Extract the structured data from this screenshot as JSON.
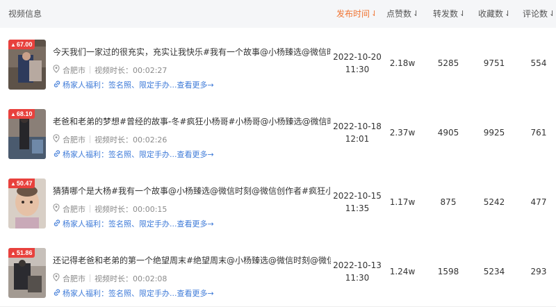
{
  "header": {
    "info": "视频信息",
    "publish_time": "发布时间",
    "likes": "点赞数",
    "shares": "转发数",
    "favorites": "收藏数",
    "comments": "评论数",
    "sort_arrow": "⇃"
  },
  "colors": {
    "accent": "#f07432",
    "badge": "#e8413d",
    "link": "#3f7bd8"
  },
  "rows": [
    {
      "score": "67.00",
      "title": "今天我们一家过的很充实，充实让我快乐#我有一个故事@小杨臻选@微信时...",
      "city": "合肥市",
      "duration_label": "视频时长：",
      "duration": "00:02:27",
      "promo": "杨家人福利：签名照、限定手办...查看更多→",
      "date": "2022-10-20",
      "time": "11:30",
      "likes": "2.18w",
      "shares": "5285",
      "favorites": "9751",
      "comments": "554"
    },
    {
      "score": "68.10",
      "title": "老爸和老弟的梦想#曾经的故事-冬#疯狂小杨哥#小杨哥@小杨臻选@微信时刻...",
      "city": "合肥市",
      "duration_label": "视频时长：",
      "duration": "00:02:26",
      "promo": "杨家人福利：签名照、限定手办...查看更多→",
      "date": "2022-10-18",
      "time": "12:01",
      "likes": "2.37w",
      "shares": "4905",
      "favorites": "9925",
      "comments": "761"
    },
    {
      "score": "50.47",
      "title": "猜猜哪个是大杨#我有一个故事@小杨臻选@微信时刻@微信创作者#疯狂小杨哥",
      "city": "合肥市",
      "duration_label": "视频时长：",
      "duration": "00:00:15",
      "promo": "杨家人福利：签名照、限定手办...查看更多→",
      "date": "2022-10-15",
      "time": "11:35",
      "likes": "1.17w",
      "shares": "875",
      "favorites": "5242",
      "comments": "477"
    },
    {
      "score": "51.86",
      "title": "还记得老爸和老弟的第一个绝望周末#绝望周末@小杨臻选@微信时刻@微信...",
      "city": "合肥市",
      "duration_label": "视频时长：",
      "duration": "00:02:08",
      "promo": "杨家人福利：签名照、限定手办...查看更多→",
      "date": "2022-10-13",
      "time": "11:30",
      "likes": "1.24w",
      "shares": "1598",
      "favorites": "5234",
      "comments": "293"
    }
  ]
}
